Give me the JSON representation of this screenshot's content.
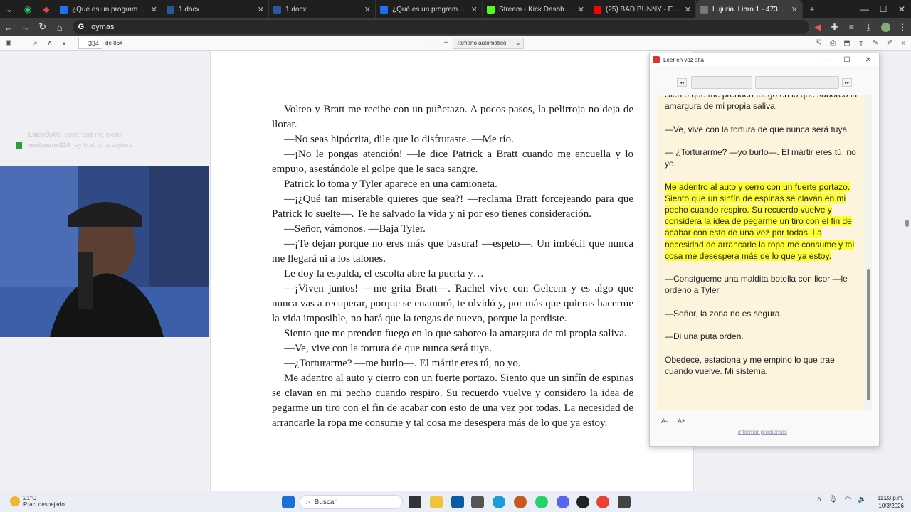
{
  "browser": {
    "tabs": [
      {
        "title": "¿Qué es un programa de pr...",
        "color": "#1a73e8",
        "active": false
      },
      {
        "title": "1.docx",
        "color": "#2b579a",
        "active": false
      },
      {
        "title": "1.docx",
        "color": "#2b579a",
        "active": false
      },
      {
        "title": "¿Qué es un programa de pr...",
        "color": "#1a73e8",
        "active": false
      },
      {
        "title": "Stream - Kick Dashboard",
        "color": "#53fc18",
        "active": false
      },
      {
        "title": "(25) BAD BUNNY - EL CLÚB |...",
        "color": "#ff0000",
        "active": false
      },
      {
        "title": "Lujuria. Libro 1 - 4735ff84-a...",
        "color": "#777777",
        "active": true
      }
    ],
    "address": "oymas",
    "new_tab": "+"
  },
  "pdf_toolbar": {
    "page_current": "334",
    "page_total": "de 864",
    "zoom_minus": "—",
    "zoom_plus": "+",
    "zoom_label": "Tamaño automático"
  },
  "chat": [
    {
      "user": "LaidyDy06",
      "message": "cómo que no, existir"
    },
    {
      "user": "marianano224",
      "message": "ay bratt si te supiera"
    }
  ],
  "page": {
    "paragraphs": [
      "Volteo y Bratt me recibe con un puñetazo. A pocos pasos, la pelirroja no deja de llorar.",
      "—No seas hipócrita, dile que lo disfrutaste. —Me río.",
      "—¡No le pongas atención! —le dice Patrick a Bratt cuando me encuella y lo empujo, asestándole el golpe que le saca sangre.",
      "Patrick lo toma y Tyler aparece en una camioneta.",
      "—¡¿Qué tan miserable quieres que sea?! —reclama Bratt forcejeando para que Patrick lo suelte—. Te he salvado la vida y ni por eso tienes consideración.",
      "—Señor, vámonos. —Baja Tyler.",
      "—¡Te dejan porque no eres más que basura! —espeto—. Un imbécil que nunca me llegará ni a los talones.",
      "Le doy la espalda, el escolta abre la puerta y…",
      "—¡Viven juntos! —me grita Bratt—. Rachel vive con Gelcem y es algo que nunca vas a recuperar, porque se enamoró, te olvidó y, por más que quieras hacerme la vida imposible, no hará que la tengas de nuevo, porque la perdiste.",
      "Siento que me prenden fuego en lo que saboreo la amargura de mi propia saliva.",
      "—Ve, vive con la tortura de que nunca será tuya.",
      "—¿Torturarme? —me burlo—. El mártir eres tú, no yo.",
      "Me adentro al auto y cierro con un fuerte portazo. Siento que un sinfín de espinas se clavan en mi pecho cuando respiro. Su recuerdo vuelve y considero la idea de pegarme un tiro con el fin de acabar con esto de una vez por todas. La necesidad de arrancarle la ropa me consume y tal cosa me desespera más de lo que ya estoy."
    ]
  },
  "read_aloud": {
    "title": "Leer en voz alta",
    "paragraphs": [
      {
        "text": "Siento que me prenden fuego en lo que saboreo la amargura de mi propia saliva.",
        "highlight": false
      },
      {
        "text": "—Ve, vive con la tortura de que nunca será tuya.",
        "highlight": false
      },
      {
        "text": "— ¿Torturarme? —yo burlo—. El mártir eres tú, no yo.",
        "highlight": false
      },
      {
        "text": "Me adentro al auto y cerro con un fuerte portazo. Siento que un sinfín de espinas se clavan en mi pecho cuando respiro. Su recuerdo vuelve y considera la idea de pegarme un tiro con el fin de acabar con esto de una vez por todas. La necesidad de arrancarle la ropa me consume y tal cosa me desespera más de lo que ya estoy.",
        "highlight": true
      },
      {
        "text": "—Consígueme una maldita botella con licor —le ordeno a Tyler.",
        "highlight": false
      },
      {
        "text": "—Señor, la zona no es segura.",
        "highlight": false
      },
      {
        "text": "—Di una puta orden.",
        "highlight": false
      },
      {
        "text": "Obedece, estaciona y me empino lo que trae cuando vuelve. Mi sistema.",
        "highlight": false
      }
    ],
    "font_smaller": "A-",
    "font_larger": "A+",
    "report": "informar problemas",
    "highlight_color": "#ffff2d"
  },
  "taskbar": {
    "weather_temp": "21°C",
    "weather_desc": "Prac. despejado",
    "search_label": "Buscar",
    "time": "11:23 p.m.",
    "date": "10/3/2026"
  }
}
